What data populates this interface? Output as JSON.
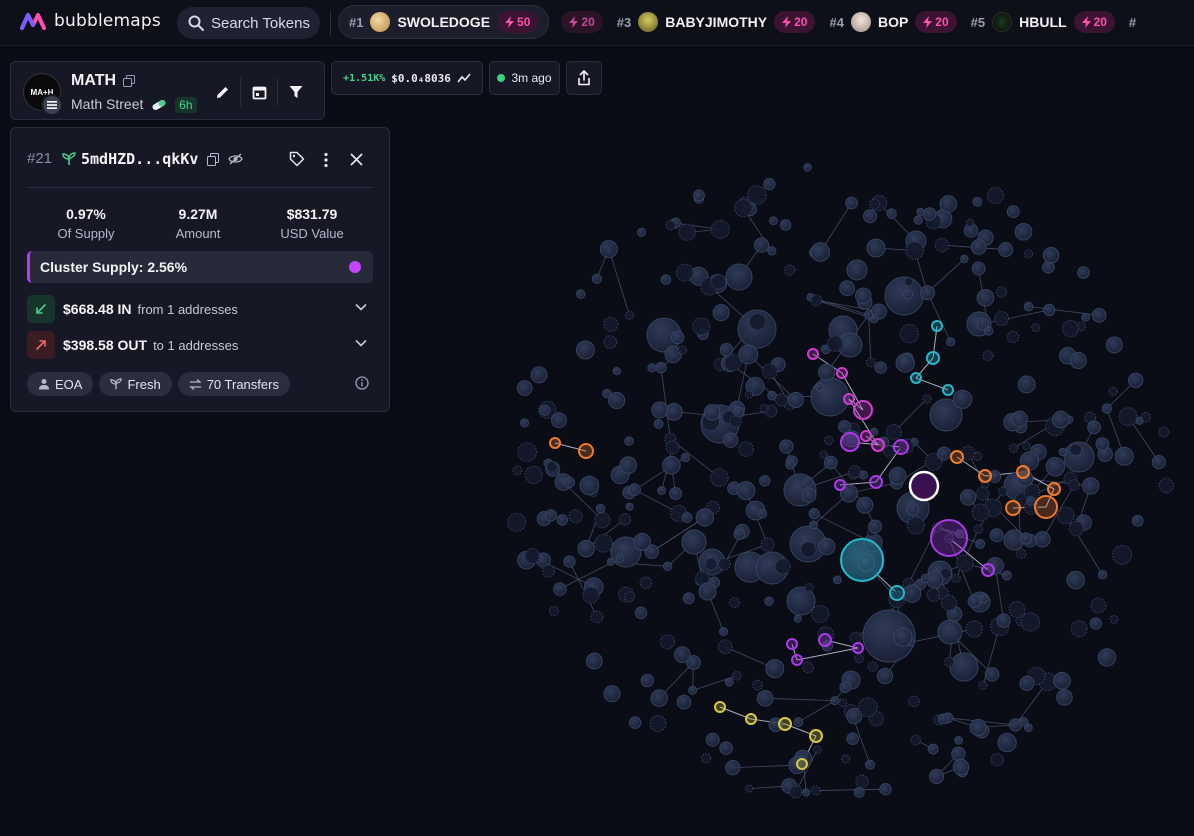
{
  "app": {
    "name": "bubblemaps",
    "search_label": "Search Tokens"
  },
  "trending": [
    {
      "rank": "#1",
      "name": "SWOLEDOGE",
      "boost": "50",
      "boost2": "20"
    },
    {
      "rank": "#3",
      "name": "BABYJIMOTHY",
      "boost": "20"
    },
    {
      "rank": "#4",
      "name": "BOP",
      "boost": "20"
    },
    {
      "rank": "#5",
      "name": "HBULL",
      "boost": "20"
    },
    {
      "rank": "#"
    }
  ],
  "token": {
    "symbol": "MATH",
    "name": "Math Street",
    "age": "6h",
    "logo_text": "MA+H"
  },
  "price": {
    "change": "+1.51K%",
    "value": "$0.0₄8036"
  },
  "updated": "3m ago",
  "wallet": {
    "rank": "#21",
    "address": "5mdHZD...qkKv",
    "stats": [
      {
        "value": "0.97%",
        "label": "Of Supply"
      },
      {
        "value": "9.27M",
        "label": "Amount"
      },
      {
        "value": "$831.79",
        "label": "USD Value"
      }
    ],
    "cluster_supply": "Cluster Supply: 2.56%",
    "flow_in": {
      "amount": "$668.48 IN",
      "sub": "from 1 addresses"
    },
    "flow_out": {
      "amount": "$398.58 OUT",
      "sub": "to 1 addresses"
    },
    "tags": [
      "EOA",
      "Fresh",
      "70 Transfers"
    ]
  },
  "colors": {
    "bg": "#0b0d16",
    "node": "#1e2a45",
    "magenta": "#d23cd0",
    "purple": "#a93ae8",
    "cyan": "#22b8c9",
    "orange": "#f07a2a",
    "yellow": "#d8c840",
    "pink_boost": "#ff4fb0"
  }
}
